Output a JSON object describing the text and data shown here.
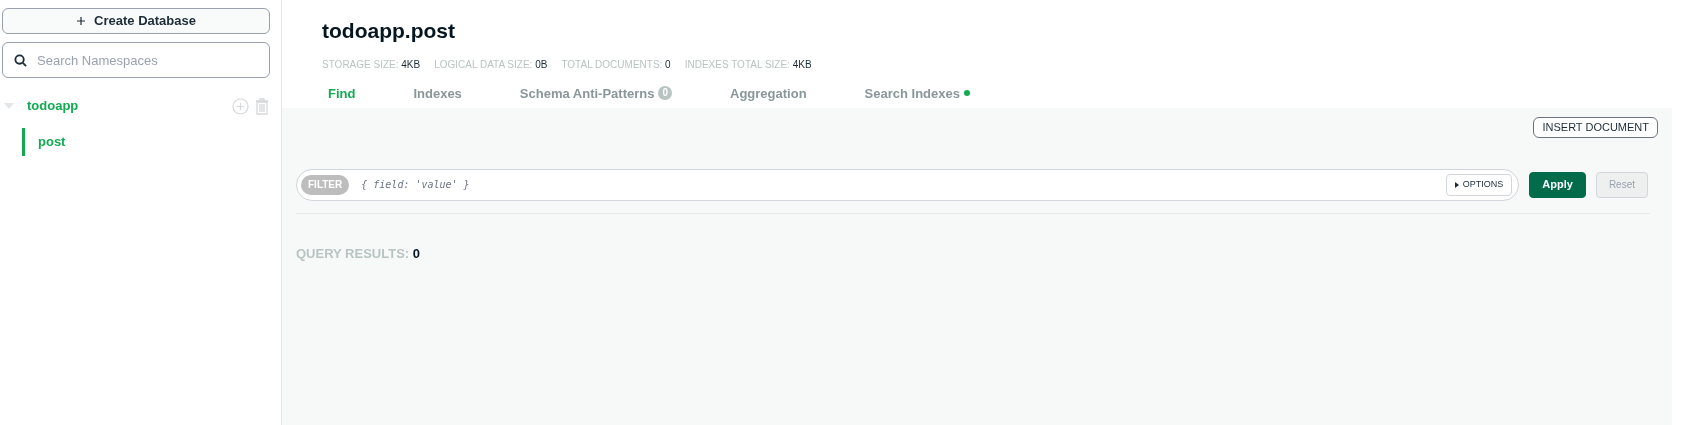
{
  "sidebar": {
    "create_button": "Create Database",
    "search": {
      "placeholder": "Search Namespaces"
    },
    "databases": [
      {
        "name": "todoapp",
        "expanded": true,
        "children": [
          {
            "name": "post",
            "selected": true
          }
        ]
      }
    ]
  },
  "header": {
    "title": "todoapp.post",
    "stats": [
      {
        "label": "STORAGE SIZE:",
        "value": "4KB"
      },
      {
        "label": "LOGICAL DATA SIZE:",
        "value": "0B"
      },
      {
        "label": "TOTAL DOCUMENTS:",
        "value": "0"
      },
      {
        "label": "INDEXES TOTAL SIZE:",
        "value": "4KB"
      }
    ]
  },
  "tabs": [
    {
      "label": "Find",
      "selected": true
    },
    {
      "label": "Indexes",
      "selected": false
    },
    {
      "label": "Schema Anti-Patterns",
      "selected": false,
      "badge": "0"
    },
    {
      "label": "Aggregation",
      "selected": false
    },
    {
      "label": "Search Indexes",
      "selected": false,
      "dot": true
    }
  ],
  "insert_button": "INSERT DOCUMENT",
  "filter": {
    "tag": "FILTER",
    "placeholder": "{ field: 'value' }",
    "options_button": "OPTIONS"
  },
  "apply_button": {
    "label": "Apply",
    "disabled": false
  },
  "reset_button": {
    "label": "Reset",
    "disabled": true
  },
  "query_results": {
    "label": "QUERY RESULTS:",
    "value": "0"
  }
}
